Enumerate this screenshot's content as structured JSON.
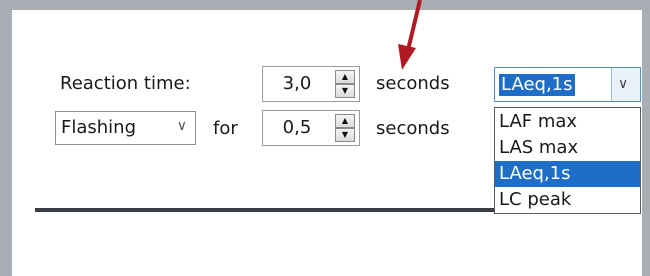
{
  "reaction": {
    "label": "Reaction time:",
    "value": "3,0",
    "unit": "seconds"
  },
  "flashing": {
    "mode": "Flashing",
    "for_label": "for",
    "value": "0,5",
    "unit": "seconds"
  },
  "metric": {
    "selected": "LAeq,1s",
    "options": [
      "LAF max",
      "LAS max",
      "LAeq,1s",
      "LC peak"
    ]
  },
  "colors": {
    "arrow": "#b01a22",
    "selection": "#1e6ec8",
    "frame": "#a9adb4"
  },
  "icons": {
    "spin_up": "triangle-up",
    "spin_down": "triangle-down",
    "dropdown": "chevron-down"
  }
}
